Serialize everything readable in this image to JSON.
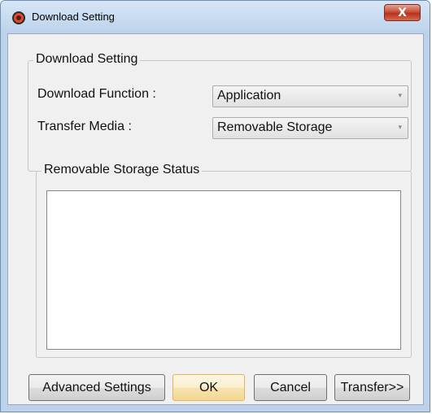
{
  "window": {
    "title": "Download Setting",
    "close_glyph": "X"
  },
  "download_group": {
    "legend": "Download Setting",
    "download_function_label": "Download Function :",
    "download_function_value": "Application",
    "transfer_media_label": "Transfer Media :",
    "transfer_media_value": "Removable Storage",
    "dropdown_arrow": "▾"
  },
  "status_group": {
    "legend": "Removable Storage Status",
    "content": ""
  },
  "buttons": {
    "advanced": "Advanced Settings",
    "ok": "OK",
    "cancel": "Cancel",
    "transfer": "Transfer>>"
  },
  "icons": {
    "app": "app-icon",
    "close": "close-icon",
    "dropdown": "chevron-down-icon"
  }
}
